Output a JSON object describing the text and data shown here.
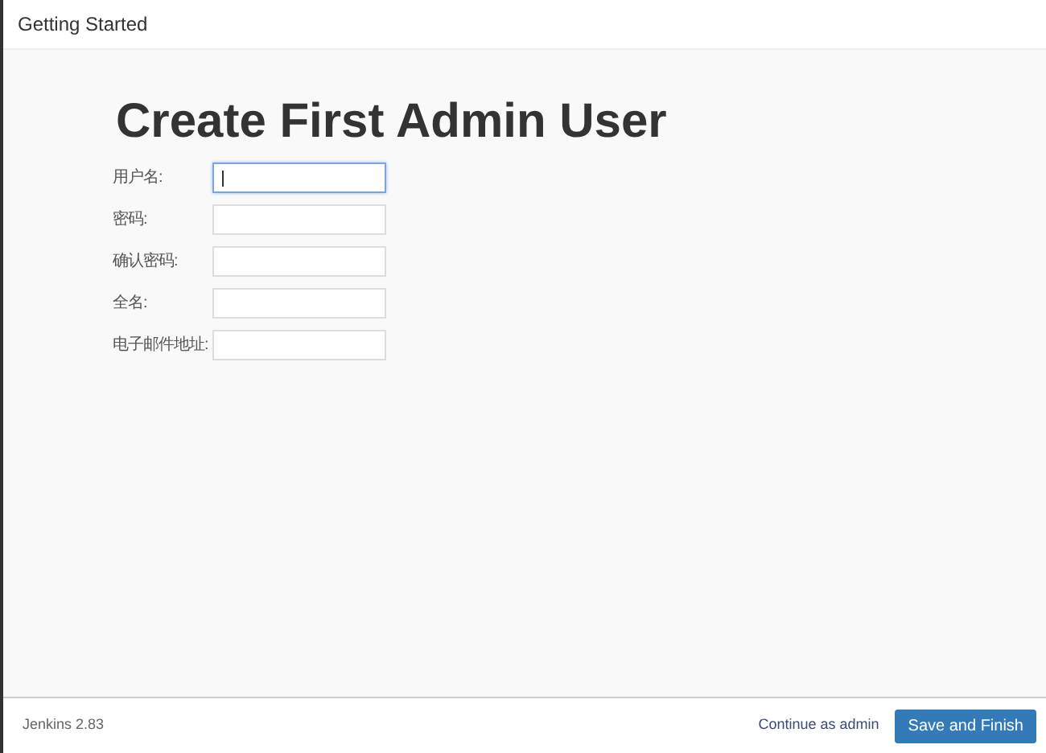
{
  "header": {
    "title": "Getting Started"
  },
  "form": {
    "title": "Create First Admin User",
    "fields": [
      {
        "label": "用户名:",
        "focused": true
      },
      {
        "label": "密码:",
        "focused": false
      },
      {
        "label": "确认密码:",
        "focused": false
      },
      {
        "label": "全名:",
        "focused": false
      },
      {
        "label": "电子邮件地址:",
        "focused": false
      }
    ]
  },
  "footer": {
    "version": "Jenkins 2.83",
    "buttons": [
      {
        "label": "Continue as admin",
        "kind": "link"
      },
      {
        "label": "Save and Finish",
        "kind": "primary"
      }
    ]
  }
}
